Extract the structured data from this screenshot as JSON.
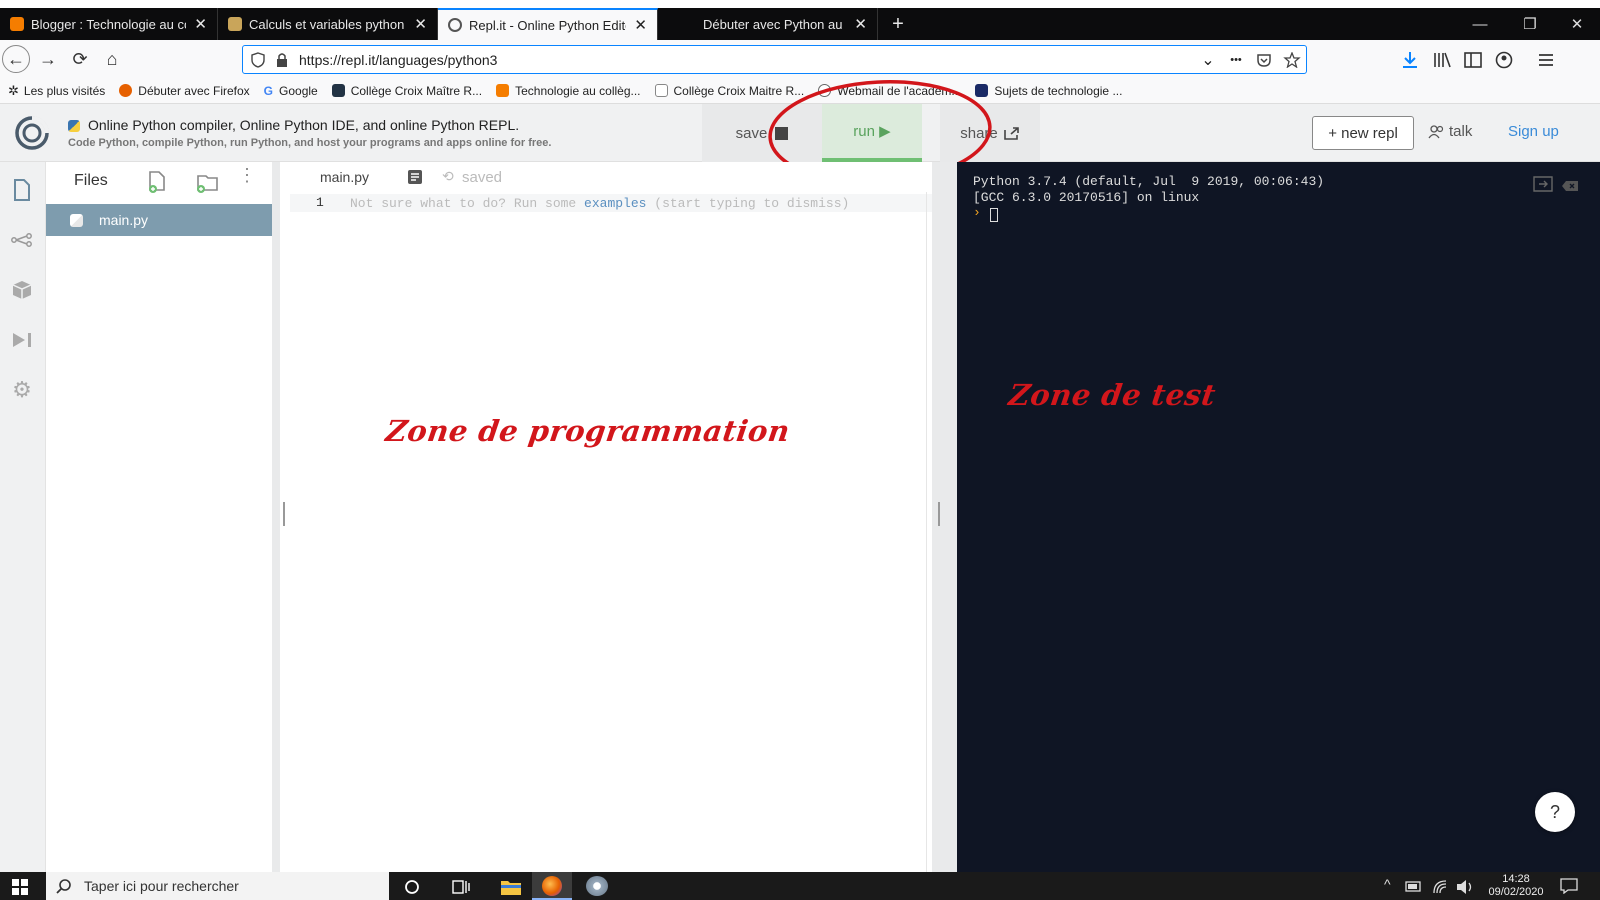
{
  "tabs": [
    {
      "title": "Blogger : Technologie au collèg",
      "fav_color": "#f57d00",
      "active": false
    },
    {
      "title": "Calculs et variables python",
      "fav_color": "#c9a55a",
      "active": false
    },
    {
      "title": "Repl.it - Online Python Editor a",
      "fav_color": "#ffffff",
      "active": true
    },
    {
      "title": "Débuter avec Python au lycée",
      "fav_color": "#0c0c0d",
      "active": false
    }
  ],
  "tab_close": "✕",
  "new_tab": "+",
  "window_controls": {
    "minimize": "—",
    "restore": "❐",
    "close": "✕"
  },
  "nav": {
    "back": "←",
    "forward": "→",
    "reload": "⟳",
    "home": "⌂"
  },
  "url": "https://repl.it/languages/python3",
  "url_actions": {
    "dropdown": "⌄",
    "more": "•••"
  },
  "bookmarks": [
    {
      "label": "Les plus visités",
      "color": "#555"
    },
    {
      "label": "Débuter avec Firefox",
      "color": "#e66000"
    },
    {
      "label": "Google",
      "color": "#4285f4"
    },
    {
      "label": "Collège Croix Maître R...",
      "color": "#234"
    },
    {
      "label": "Technologie au collèg...",
      "color": "#f57d00"
    },
    {
      "label": "Collège Croix Maitre R...",
      "color": "#888"
    },
    {
      "label": "Webmail de l'académ...",
      "color": "#666"
    },
    {
      "label": "Sujets de technologie ...",
      "color": "#1a2a66"
    }
  ],
  "repl_header": {
    "title": "Online Python compiler, Online Python IDE, and online Python REPL.",
    "subtitle": "Code Python, compile Python, run Python, and host your programs and apps online for free.",
    "save": "save",
    "run": "run ▶",
    "share": "share",
    "new_repl": "+ new repl",
    "talk": "talk",
    "sign_up": "Sign up"
  },
  "files": {
    "heading": "Files",
    "items": [
      {
        "name": "main.py",
        "selected": true
      }
    ]
  },
  "editor": {
    "tab": "main.py",
    "status": "saved",
    "line_number": "1",
    "hint_before": "Not sure what to do? Run some ",
    "hint_link": "examples",
    "hint_after": " (start typing to dismiss)"
  },
  "console": {
    "line1": "Python 3.7.4 (default, Jul  9 2019, 00:06:43)",
    "line2": "[GCC 6.3.0 20170516] on linux",
    "prompt": "›"
  },
  "annotations": {
    "programming_zone": "Zone de programmation",
    "test_zone": "Zone de test"
  },
  "help_button": "?",
  "taskbar": {
    "search_placeholder": "Taper ici pour rechercher",
    "time": "14:28",
    "date": "09/02/2020"
  },
  "colors": {
    "accent": "#0a84ff",
    "run_green": "#6fbf73",
    "annotation_red": "#d2161b",
    "console_bg": "#0f1524"
  }
}
